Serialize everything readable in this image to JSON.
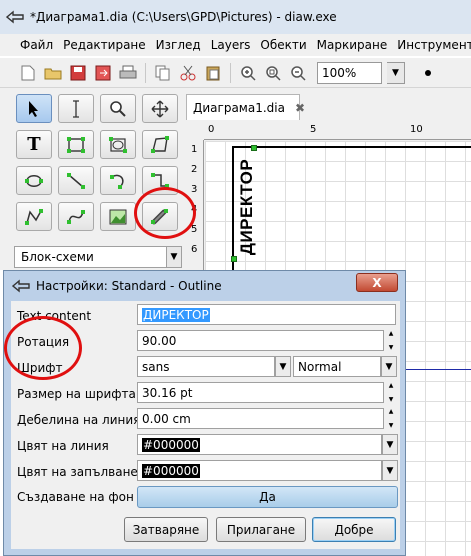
{
  "window": {
    "title": "*Диаграма1.dia (C:\\Users\\GPD\\Pictures) - diaw.exe"
  },
  "menu": [
    "Файл",
    "Редактиране",
    "Изглед",
    "Layers",
    "Обекти",
    "Маркиране",
    "Инструменти"
  ],
  "toolbar": {
    "zoom": "100%",
    "icons": [
      "new-icon",
      "open-icon",
      "save-icon",
      "export-icon",
      "print-icon",
      "copy-icon",
      "cut-icon",
      "paste-icon",
      "zoom-in-icon",
      "zoom-fit-icon",
      "zoom-out-icon"
    ]
  },
  "toolbox": {
    "tools": [
      "select",
      "text-cursor",
      "magnify",
      "move",
      "text",
      "box",
      "ellipse-box",
      "polygon",
      "bezier-polygon",
      "line",
      "arc",
      "zigzag",
      "polyline",
      "bezier",
      "image",
      "outline"
    ],
    "active_tool": "select",
    "sheet": "Блок-схеми"
  },
  "document": {
    "tab_label": "Диаграма1.dia",
    "ruler_h": [
      "0",
      "5",
      "10"
    ],
    "ruler_v": [
      "1",
      "2",
      "3",
      "4",
      "5",
      "6"
    ],
    "object_text": "ДИРЕКТОР"
  },
  "dialog": {
    "title": "Настройки: Standard - Outline",
    "close": "X",
    "labels": {
      "text_content": "Text content",
      "rotation": "Ротация",
      "font": "Шрифт",
      "font_size": "Размер на шрифта",
      "line_width": "Дебелина на линия",
      "line_color": "Цвят на линия",
      "fill_color": "Цвят на запълването",
      "show_background": "Създаване на фон"
    },
    "values": {
      "text_content": "ДИРЕКТОР",
      "rotation": "90.00",
      "font": "sans",
      "font_style": "Normal",
      "font_size": "30.16 pt",
      "line_width": "0.00 cm",
      "line_color": "#000000",
      "fill_color": "#000000",
      "show_background": "Да"
    },
    "buttons": {
      "close": "Затваряне",
      "apply": "Прилагане",
      "ok": "Добре"
    }
  },
  "colors": {
    "annotation": "#e01010",
    "selection_handle": "#2fbf2f"
  }
}
